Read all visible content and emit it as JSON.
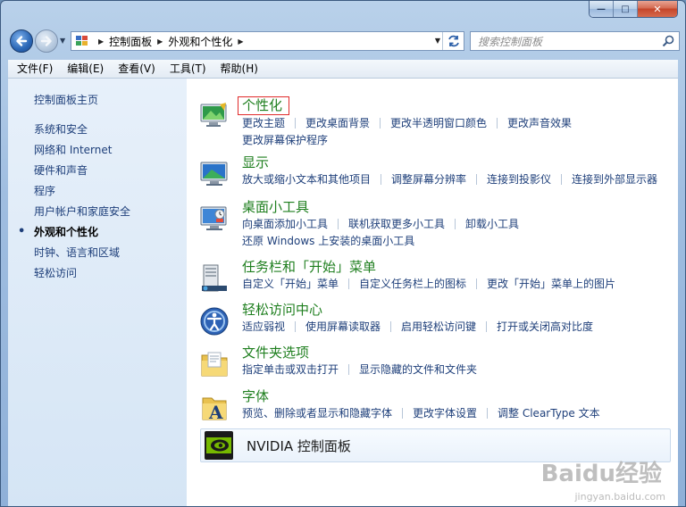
{
  "window": {
    "caption": {
      "minimize": "—",
      "maximize": "□",
      "close": "✕"
    }
  },
  "nav": {
    "breadcrumbs": [
      "控制面板",
      "外观和个性化"
    ],
    "search_placeholder": "搜索控制面板"
  },
  "menu": [
    "文件(F)",
    "编辑(E)",
    "查看(V)",
    "工具(T)",
    "帮助(H)"
  ],
  "sidebar": {
    "home": "控制面板主页",
    "items": [
      {
        "label": "系统和安全"
      },
      {
        "label": "网络和 Internet"
      },
      {
        "label": "硬件和声音"
      },
      {
        "label": "程序"
      },
      {
        "label": "用户帐户和家庭安全"
      },
      {
        "label": "外观和个性化",
        "current": true
      },
      {
        "label": "时钟、语言和区域"
      },
      {
        "label": "轻松访问"
      }
    ]
  },
  "categories": [
    {
      "title": "个性化",
      "icon": "personalization-icon",
      "links": [
        "更改主题",
        "更改桌面背景",
        "更改半透明窗口颜色",
        "更改声音效果",
        "|",
        "更改屏幕保护程序"
      ]
    },
    {
      "title": "显示",
      "icon": "display-icon",
      "links": [
        "放大或缩小文本和其他项目",
        "调整屏幕分辨率",
        "连接到投影仪",
        "连接到外部显示器"
      ]
    },
    {
      "title": "桌面小工具",
      "icon": "gadgets-icon",
      "links": [
        "向桌面添加小工具",
        "联机获取更多小工具",
        "卸载小工具",
        "|",
        "还原 Windows 上安装的桌面小工具"
      ]
    },
    {
      "title": "任务栏和「开始」菜单",
      "icon": "taskbar-icon",
      "links": [
        "自定义「开始」菜单",
        "自定义任务栏上的图标",
        "更改「开始」菜单上的图片"
      ]
    },
    {
      "title": "轻松访问中心",
      "icon": "ease-of-access-icon",
      "links": [
        "适应弱视",
        "使用屏幕读取器",
        "启用轻松访问键",
        "打开或关闭高对比度"
      ]
    },
    {
      "title": "文件夹选项",
      "icon": "folder-options-icon",
      "links": [
        "指定单击或双击打开",
        "显示隐藏的文件和文件夹"
      ]
    },
    {
      "title": "字体",
      "icon": "fonts-icon",
      "links": [
        "预览、删除或者显示和隐藏字体",
        "更改字体设置",
        "调整 ClearType 文本"
      ]
    }
  ],
  "nvidia": {
    "title": "NVIDIA 控制面板",
    "icon": "nvidia-icon"
  },
  "watermark": {
    "main": "Baidu经验",
    "sub": "jingyan.baidu.com"
  }
}
